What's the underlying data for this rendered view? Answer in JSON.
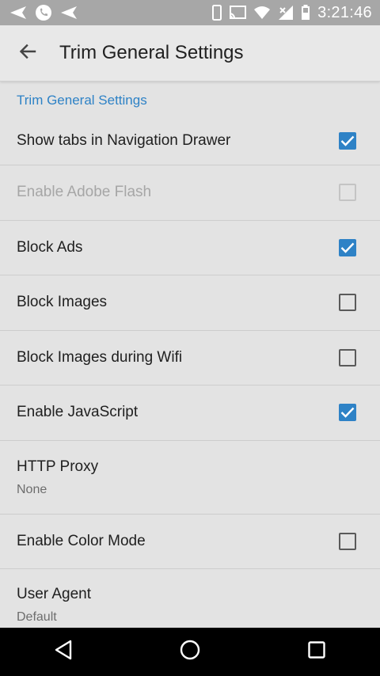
{
  "status_bar": {
    "time": "3:21:46",
    "icons": [
      "send-icon",
      "phone-icon",
      "send-icon",
      "phone-device-icon",
      "cast-icon",
      "wifi-icon",
      "signal-icon",
      "battery-icon"
    ]
  },
  "app_bar": {
    "title": "Trim General Settings",
    "back_icon": "arrow-left-icon"
  },
  "settings": {
    "category": "Trim General Settings",
    "items": [
      {
        "label": "Show tabs in Navigation Drawer",
        "checked": true,
        "enabled": true
      },
      {
        "label": "Enable Adobe Flash",
        "checked": false,
        "enabled": false
      },
      {
        "label": "Block Ads",
        "checked": true,
        "enabled": true
      },
      {
        "label": "Block Images",
        "checked": false,
        "enabled": true
      },
      {
        "label": "Block Images during Wifi",
        "checked": false,
        "enabled": true
      },
      {
        "label": "Enable JavaScript",
        "checked": true,
        "enabled": true
      },
      {
        "label": "HTTP Proxy",
        "summary": "None"
      },
      {
        "label": "Enable Color Mode",
        "checked": false,
        "enabled": true
      },
      {
        "label": "User Agent",
        "summary": "Default"
      }
    ]
  },
  "nav_bar": {
    "icons": [
      "back-triangle-icon",
      "home-circle-icon",
      "recents-square-icon"
    ]
  },
  "colors": {
    "accent": "#2e82c6",
    "background": "#e3e3e3",
    "status_bar": "#a7a7a7",
    "nav_bar": "#000000"
  }
}
